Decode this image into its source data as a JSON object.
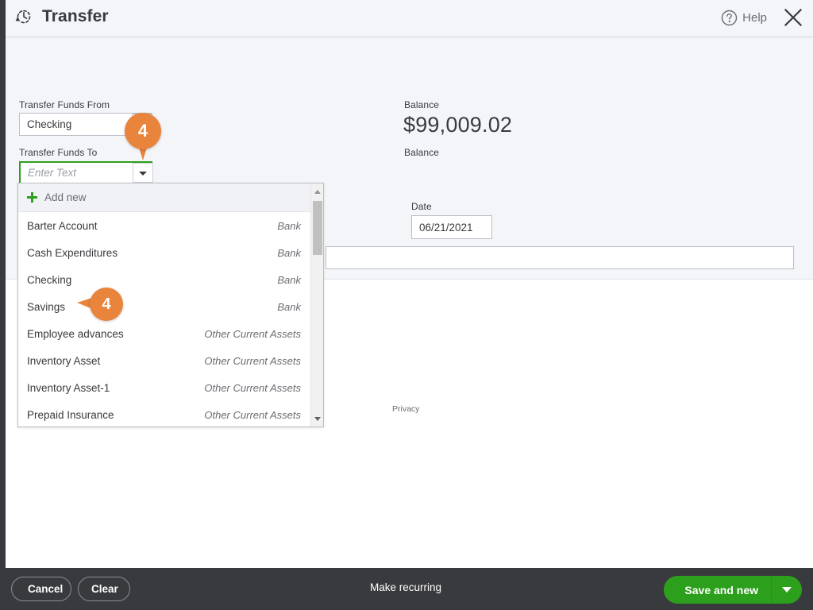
{
  "header": {
    "title": "Transfer",
    "recurring_icon": "recurring-transaction-icon",
    "help_label": "Help",
    "help_icon": "question-circle-icon",
    "close_icon": "close-x-icon"
  },
  "form": {
    "transfer_from_label": "Transfer Funds From",
    "transfer_from_value": "Checking",
    "transfer_to_label": "Transfer Funds To",
    "transfer_to_value": "",
    "transfer_to_placeholder": "Enter Text",
    "balance_label_1": "Balance",
    "balance_amount": "$99,009.02",
    "balance_label_2": "Balance",
    "date_label": "Date",
    "date_value": "06/21/2021",
    "memo_value": "",
    "memo_placeholder": "",
    "privacy_link": "Privacy"
  },
  "dropdown": {
    "add_new_label": "Add new",
    "add_new_icon": "plus-icon",
    "scroll_up_icon": "scroll-up-arrow-icon",
    "scroll_down_icon": "scroll-down-arrow-icon",
    "items": [
      {
        "name": "Barter Account",
        "type": "Bank"
      },
      {
        "name": "Cash Expenditures",
        "type": "Bank"
      },
      {
        "name": "Checking",
        "type": "Bank"
      },
      {
        "name": "Savings",
        "type": "Bank"
      },
      {
        "name": "Employee advances",
        "type": "Other Current Assets"
      },
      {
        "name": "Inventory Asset",
        "type": "Other Current Assets"
      },
      {
        "name": "Inventory Asset-1",
        "type": "Other Current Assets"
      },
      {
        "name": "Prepaid Insurance",
        "type": "Other Current Assets"
      }
    ]
  },
  "callouts": {
    "step_field": "4",
    "step_item": "4"
  },
  "footer": {
    "cancel_label": "Cancel",
    "clear_label": "Clear",
    "make_recurring_label": "Make recurring",
    "save_label": "Save and new",
    "save_caret_icon": "chevron-down-icon"
  },
  "colors": {
    "accent_green": "#2ca01c",
    "callout_orange": "#e8843c",
    "footer_dark": "#393a3d",
    "panel_grey": "#f4f5f8"
  }
}
